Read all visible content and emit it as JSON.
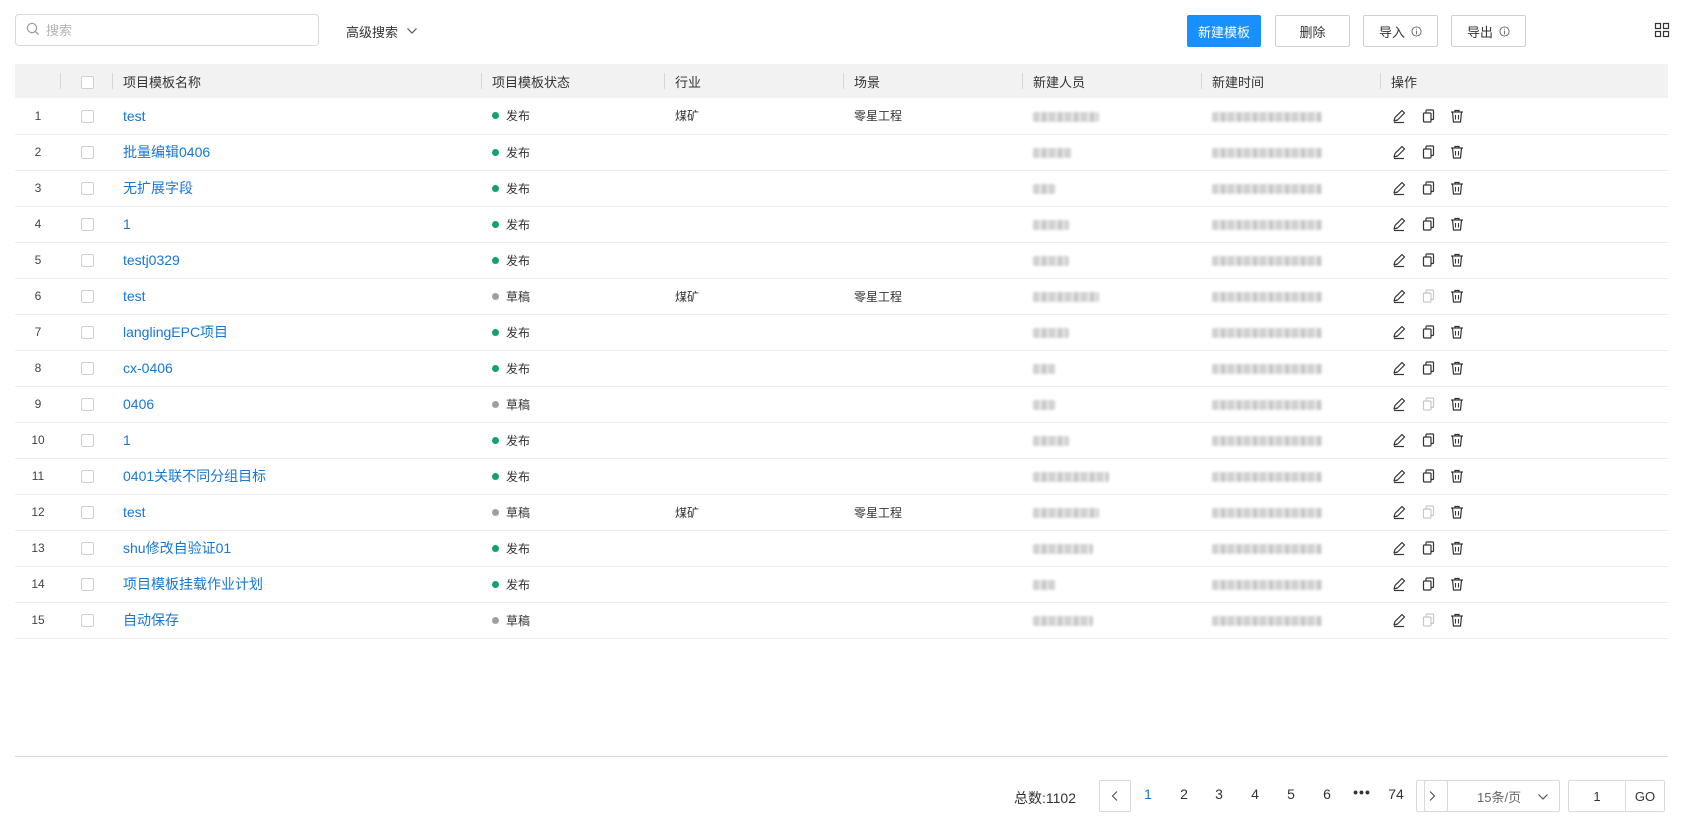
{
  "toolbar": {
    "search_placeholder": "搜索",
    "advanced_search": "高级搜索",
    "new_template": "新建模板",
    "delete": "删除",
    "import": "导入",
    "export": "导出"
  },
  "table": {
    "headers": [
      "项目模板名称",
      "项目模板状态",
      "行业",
      "场景",
      "新建人员",
      "新建时间",
      "操作"
    ],
    "rows": [
      {
        "index": "1",
        "name": "test",
        "status": "发布",
        "industry": "煤矿",
        "scene": "零星工程"
      },
      {
        "index": "2",
        "name": "批量编辑0406",
        "status": "发布",
        "industry": "",
        "scene": ""
      },
      {
        "index": "3",
        "name": "无扩展字段",
        "status": "发布",
        "industry": "",
        "scene": ""
      },
      {
        "index": "4",
        "name": "1",
        "status": "发布",
        "industry": "",
        "scene": ""
      },
      {
        "index": "5",
        "name": "testj0329",
        "status": "发布",
        "industry": "",
        "scene": ""
      },
      {
        "index": "6",
        "name": "test",
        "status": "草稿",
        "industry": "煤矿",
        "scene": "零星工程"
      },
      {
        "index": "7",
        "name": "langlingEPC项目",
        "status": "发布",
        "industry": "",
        "scene": ""
      },
      {
        "index": "8",
        "name": "cx-0406",
        "status": "发布",
        "industry": "",
        "scene": ""
      },
      {
        "index": "9",
        "name": "0406",
        "status": "草稿",
        "industry": "",
        "scene": ""
      },
      {
        "index": "10",
        "name": "1",
        "status": "发布",
        "industry": "",
        "scene": ""
      },
      {
        "index": "11",
        "name": "0401关联不同分组目标",
        "status": "发布",
        "industry": "",
        "scene": ""
      },
      {
        "index": "12",
        "name": "test",
        "status": "草稿",
        "industry": "煤矿",
        "scene": "零星工程"
      },
      {
        "index": "13",
        "name": "shu修改自验证01",
        "status": "发布",
        "industry": "",
        "scene": ""
      },
      {
        "index": "14",
        "name": "项目模板挂载作业计划",
        "status": "发布",
        "industry": "",
        "scene": ""
      },
      {
        "index": "15",
        "name": "自动保存",
        "status": "草稿",
        "industry": "",
        "scene": ""
      }
    ]
  },
  "status_colors": {
    "发布": "#12a36b",
    "草稿": "#a0a0a0"
  },
  "pagination": {
    "total_label": "总数:",
    "total": "1102",
    "pages": [
      "1",
      "2",
      "3",
      "4",
      "5",
      "6"
    ],
    "current_page": "1",
    "ellipsis": "•••",
    "last_page": "74",
    "page_size": "15条/页",
    "jump_value": "1",
    "go": "GO"
  }
}
